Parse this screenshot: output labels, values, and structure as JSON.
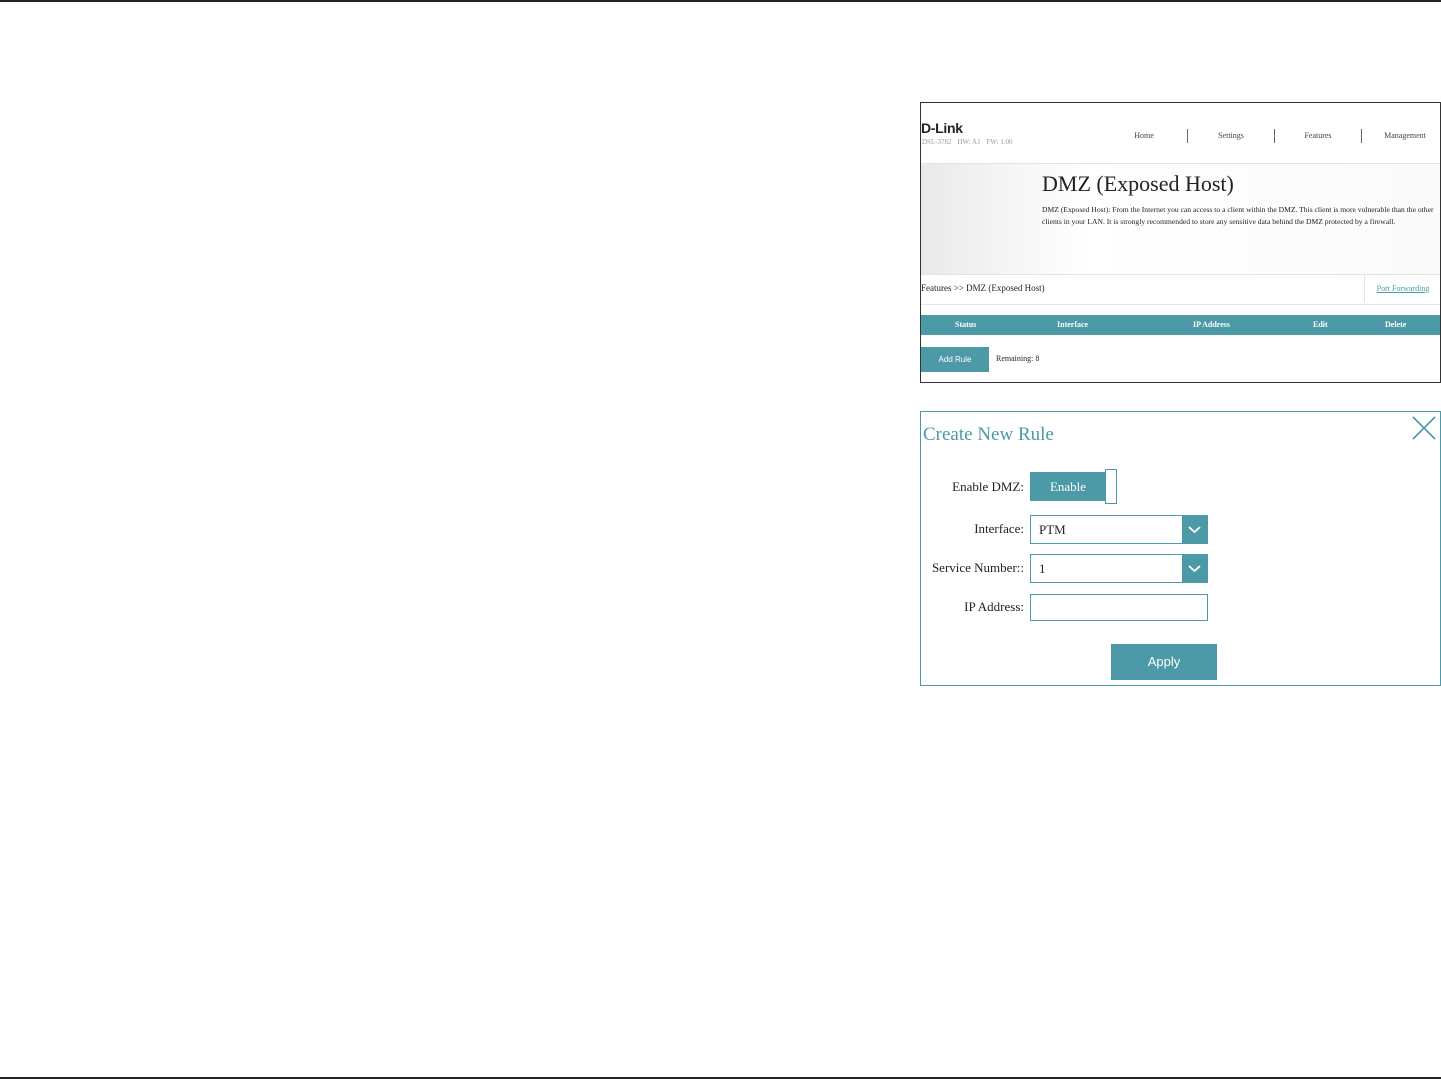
{
  "router": {
    "logo": "D-Link",
    "model": {
      "name": "DSL-3782",
      "hw": "HW: A1",
      "fw": "FW: 1.00"
    },
    "nav": [
      "Home",
      "Settings",
      "Features",
      "Management"
    ],
    "page_title": "DMZ (Exposed Host)",
    "description": "DMZ (Exposed Host): From the Internet you can access to a client within the DMZ. This client is more vulnerable than the other clients in your LAN. It is strongly recommended to store any sensitive data behind the DMZ protected by a firewall.",
    "breadcrumb": "Features >> DMZ (Exposed Host)",
    "port_forwarding_link": "Port Forwarding",
    "table_headers": [
      "Status",
      "Interface",
      "IP Address",
      "Edit",
      "Delete"
    ],
    "add_rule_label": "Add Rule",
    "remaining": "Remaining: 8"
  },
  "rule_dialog": {
    "title": "Create New Rule",
    "enable_dmz_label": "Enable DMZ:",
    "enable_toggle_text": "Enable",
    "interface_label": "Interface:",
    "interface_value": "PTM",
    "service_number_label": "Service Number::",
    "service_number_value": "1",
    "ip_address_label": "IP Address:",
    "ip_address_value": "",
    "apply_label": "Apply"
  },
  "colors": {
    "accent": "#4c9aa8",
    "text": "#222222"
  },
  "icons": {
    "close": "close-icon",
    "dropdown": "chevron-down-icon"
  }
}
